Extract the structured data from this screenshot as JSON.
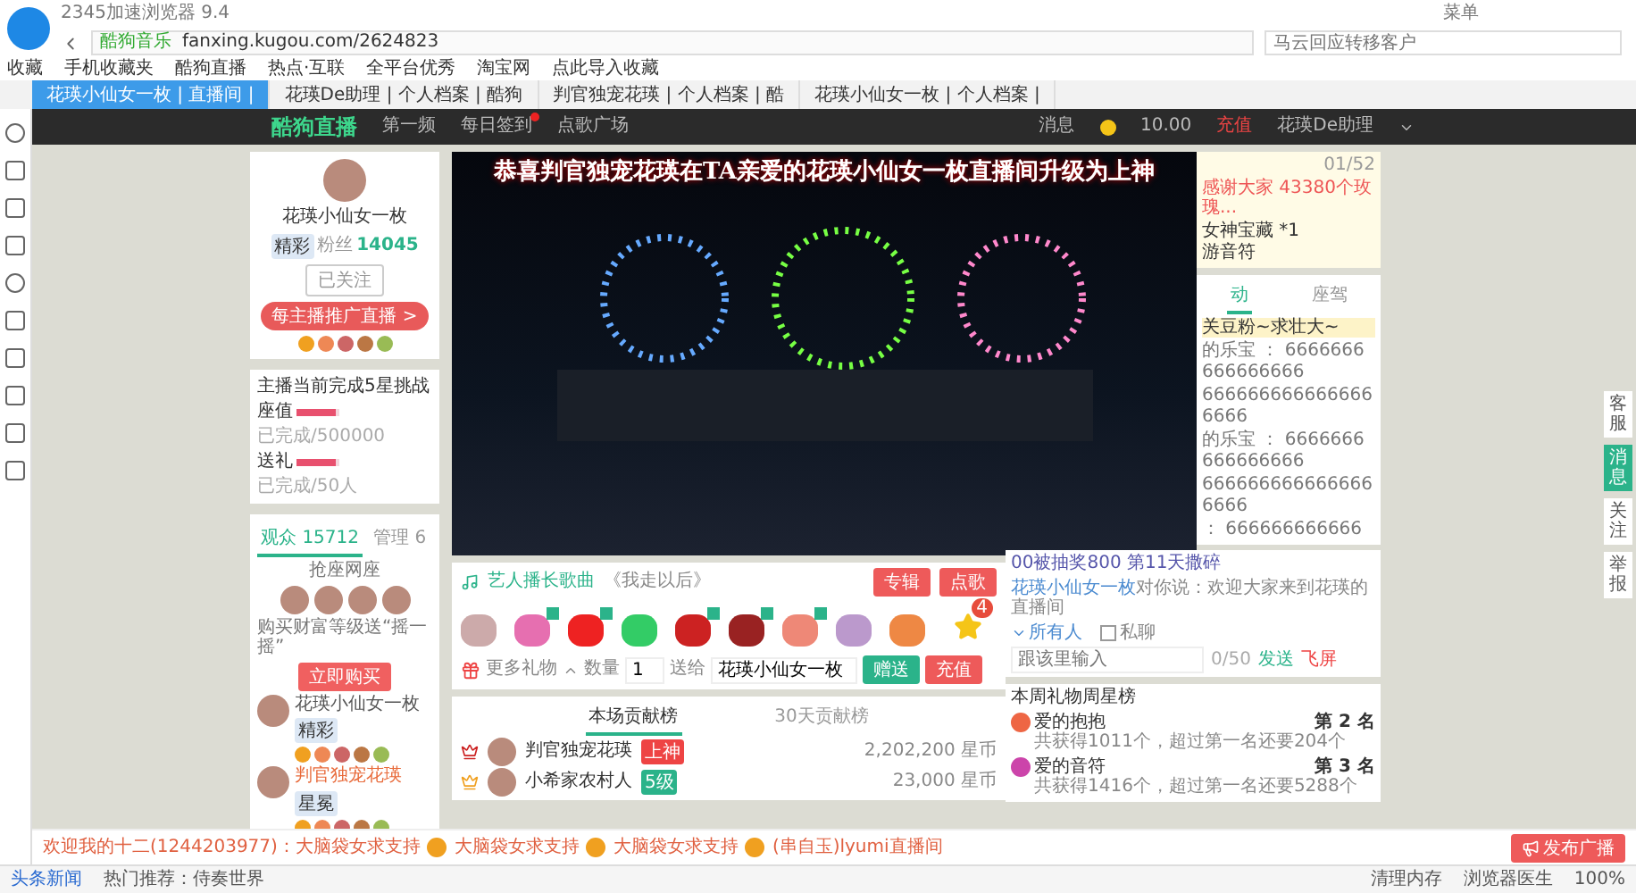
{
  "browser": {
    "title": "2345加速浏览器 9.4",
    "menu": "菜单",
    "secure_label": "酷狗音乐",
    "url": "fanxing.kugou.com/2624823",
    "search_placeholder": "马云回应转移客户"
  },
  "bookmarks": [
    "收藏",
    "手机收藏夹",
    "酷狗直播",
    "热点·互联",
    "全平台优秀",
    "淘宝网",
    "点此导入收藏"
  ],
  "tabs": [
    {
      "label": "花瑛小仙女一枚 | 直播间 |",
      "selected": true
    },
    {
      "label": "花瑛De助理 | 个人档案 | 酷狗",
      "selected": false
    },
    {
      "label": "判官独宠花瑛 | 个人档案 | 酷",
      "selected": false
    },
    {
      "label": "花瑛小仙女一枚 | 个人档案 |",
      "selected": false
    }
  ],
  "site_header": {
    "logo": "酷狗直播",
    "nav": [
      {
        "label": "第一频",
        "dot": false
      },
      {
        "label": "每日签到",
        "dot": true
      },
      {
        "label": "点歌广场",
        "dot": false
      }
    ],
    "messages": "消息",
    "balance": "10.00",
    "recharge": "充值",
    "user": "花瑛De助理"
  },
  "profile": {
    "name": "花瑛小仙女一枚",
    "badge": "精彩",
    "fans_label": "粉丝",
    "fans": "14045",
    "follow": "已关注",
    "promo": "每主播推广直播 >"
  },
  "challenge": {
    "title": "主播当前完成5星挑战",
    "rows": [
      {
        "label": "座值",
        "level": 0.9,
        "reading": "已完成/500000"
      },
      {
        "label": "送礼",
        "level": 0.9,
        "reading": "已完成/50人"
      }
    ]
  },
  "audience": {
    "tabs": [
      {
        "label": "观众",
        "count": "15712",
        "selected": true
      },
      {
        "label": "管理",
        "count": "6",
        "selected": false
      }
    ],
    "seat_title": "抢座网座",
    "promo": "购买财富等级送“摇一摇”",
    "buy": "立即购买",
    "users": [
      {
        "name": "花瑛小仙女一枚",
        "badge": "精彩"
      },
      {
        "name": "判官独宠花瑛",
        "badge": "星冕"
      }
    ]
  },
  "video": {
    "title": "恭喜判官独宠花瑛在TA亲爱的花瑛小仙女一枚直播间升级为上神"
  },
  "song": {
    "label": "艺人播长歌曲",
    "name": "《我走以后》",
    "buttons": [
      "专辑",
      "点歌"
    ]
  },
  "gifts": [
    {
      "new": false
    },
    {
      "new": true
    },
    {
      "new": true
    },
    {
      "new": false
    },
    {
      "new": true
    },
    {
      "new": true
    },
    {
      "new": true
    },
    {
      "new": false
    },
    {
      "new": false
    }
  ],
  "gift_star_count": "4",
  "send_bar": {
    "more": "更多礼物",
    "qty_label": "数量",
    "qty": "1",
    "to_label": "送给",
    "to": "花瑛小仙女一枚",
    "send": "赠送",
    "recharge": "充值"
  },
  "ranking": {
    "tabs": [
      {
        "label": "本场贡献榜",
        "selected": true
      },
      {
        "label": "30天贡献榜",
        "selected": false
      }
    ],
    "rows": [
      {
        "name": "判官独宠花瑛",
        "badge": "上神",
        "amount": "2,202,200 星币"
      },
      {
        "name": "小希家农村人",
        "badge": "5级",
        "amount": "23,000 星币"
      }
    ]
  },
  "chat": {
    "notice": "感谢大家 43380个玫瑰...",
    "page": "01/52",
    "gift_lines": [
      "女神宝藏 *1",
      "游音符"
    ],
    "tabs": [
      {
        "label": "动",
        "selected": true
      },
      {
        "label": "座驾",
        "selected": false
      }
    ],
    "banner": "关豆粉~求壮大~",
    "messages": [
      "的乐宝 ： 6666666666666666",
      "6666666666666666666",
      "的乐宝 ： 6666666666666666",
      "6666666666666666666",
      "： 666666666666"
    ],
    "system": "00被抽奖800 第11天撒碎",
    "welcome_user": "花瑛小仙女一枚",
    "welcome_text": "对你说：欢迎大家来到花瑛的直播间",
    "target": "所有人",
    "private": "私聊",
    "private_checked": false,
    "placeholder": "跟该里输入",
    "counter": "0/50",
    "send": "发送",
    "fly": "飞屏"
  },
  "weekly": {
    "title": "本周礼物周星榜",
    "rows": [
      {
        "name": "爱的抱抱",
        "rank": "第 2 名",
        "detail": "共获得1011个，超过第一名还要204个"
      },
      {
        "name": "爱的音符",
        "rank": "第 3 名",
        "detail": "共获得1416个，超过第一名还要5288个"
      }
    ]
  },
  "side_buttons": [
    {
      "label": "客服",
      "selected": false
    },
    {
      "label": "消息",
      "selected": true
    },
    {
      "label": "关注",
      "selected": false
    },
    {
      "label": "举报",
      "selected": false
    }
  ],
  "ticker": {
    "messages": [
      "欢迎我的十二(1244203977)：大脑袋女求支持",
      "大脑袋女求支持",
      "大脑袋女求支持",
      "(串自玉)lyumi直播间"
    ],
    "broadcast": "发布广播"
  },
  "status_bar": {
    "news": "头条新闻",
    "hot": "热门推荐：侍奏世界",
    "items": [
      "清理内存",
      "浏览器医生",
      "100%"
    ]
  }
}
